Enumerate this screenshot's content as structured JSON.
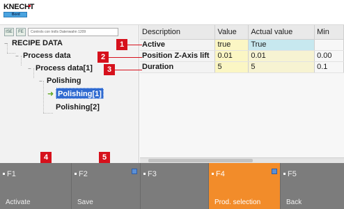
{
  "header": {
    "logo_text": "KNECHT",
    "logo_sub": "Bord"
  },
  "toolbar": {
    "btn1": "ISE",
    "btn2": "FE",
    "field_text": "Controls con trolls Datenwahn 1209"
  },
  "tree": {
    "recipe": "RECIPE DATA",
    "process": "Process data",
    "process1": "Process data[1]",
    "polishing": "Polishing",
    "polishing1": "Polishing[1]",
    "polishing2": "Polishing[2]"
  },
  "callouts": [
    "1",
    "2",
    "3",
    "4",
    "5"
  ],
  "table": {
    "headers": [
      "Description",
      "Value",
      "Actual value",
      "Min"
    ],
    "rows": [
      {
        "desc": "Active",
        "value": "true",
        "actual": "True",
        "min": ""
      },
      {
        "desc": "Position Z-Axis lift",
        "value": "0.01",
        "actual": "0.01",
        "min": "0.00"
      },
      {
        "desc": "Duration",
        "value": "5",
        "actual": "5",
        "min": "0.1"
      }
    ]
  },
  "fkeys": [
    {
      "name": "F1",
      "label": "Activate",
      "active": false
    },
    {
      "name": "F2",
      "label": "Save",
      "active": false
    },
    {
      "name": "F3",
      "label": "",
      "active": false
    },
    {
      "name": "F4",
      "label": "Prod. selection",
      "active": true
    },
    {
      "name": "F5",
      "label": "Back",
      "active": false
    }
  ],
  "colors": {
    "accent": "#f28c2a",
    "callout": "#d6111c",
    "selection": "#2f6ad0",
    "value_cell": "#fbf6c4"
  }
}
